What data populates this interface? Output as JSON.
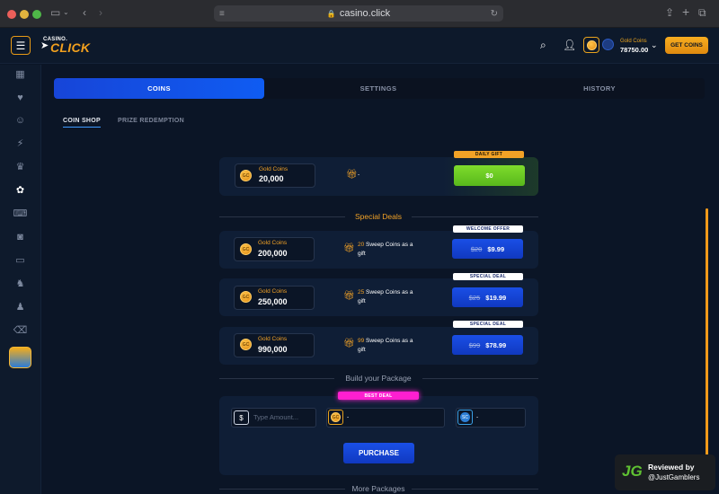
{
  "browser": {
    "url": "casino.click"
  },
  "header": {
    "logo_small": "CASINO.",
    "logo_big": "CLICK",
    "balance_label": "Gold Coins",
    "balance_value": "78750.00",
    "get_coins": "GET COINS"
  },
  "tabs": {
    "coins": "COINS",
    "settings": "SETTINGS",
    "history": "HISTORY"
  },
  "subtabs": {
    "shop": "COIN SHOP",
    "prize": "PRIZE REDEMPTION"
  },
  "coin_abbr": "GC",
  "sc_abbr": "SC",
  "daily": {
    "badge": "DAILY GIFT",
    "label": "Gold Coins",
    "amount": "20,000",
    "gift_text": "-",
    "price": "$0"
  },
  "special_deals_title": "Special Deals",
  "deals": [
    {
      "badge": "WELCOME OFFER",
      "label": "Gold Coins",
      "amount": "200,000",
      "sc_count": "20",
      "sc_text": "Sweep Coins as a",
      "sc_text2": "gift",
      "old_price": "$20",
      "price": "$9.99"
    },
    {
      "badge": "SPECIAL DEAL",
      "label": "Gold Coins",
      "amount": "250,000",
      "sc_count": "25",
      "sc_text": "Sweep Coins as a",
      "sc_text2": "gift",
      "old_price": "$25",
      "price": "$19.99"
    },
    {
      "badge": "SPECIAL DEAL",
      "label": "Gold Coins",
      "amount": "990,000",
      "sc_count": "99",
      "sc_text": "Sweep Coins as a",
      "sc_text2": "gift",
      "old_price": "$99",
      "price": "$78.99"
    }
  ],
  "build": {
    "title": "Build your Package",
    "badge": "BEST DEAL",
    "placeholder": "Type Amount...",
    "gc_value": "-",
    "sc_value": "-",
    "purchase": "PURCHASE"
  },
  "more_packages": "More Packages",
  "watermark": {
    "line1": "Reviewed by",
    "line2": "@JustGamblers"
  },
  "colors": {
    "accent": "#f2a226",
    "primary": "#1a4fe6",
    "green": "#6fd125",
    "best_deal": "#ff1fd0"
  }
}
